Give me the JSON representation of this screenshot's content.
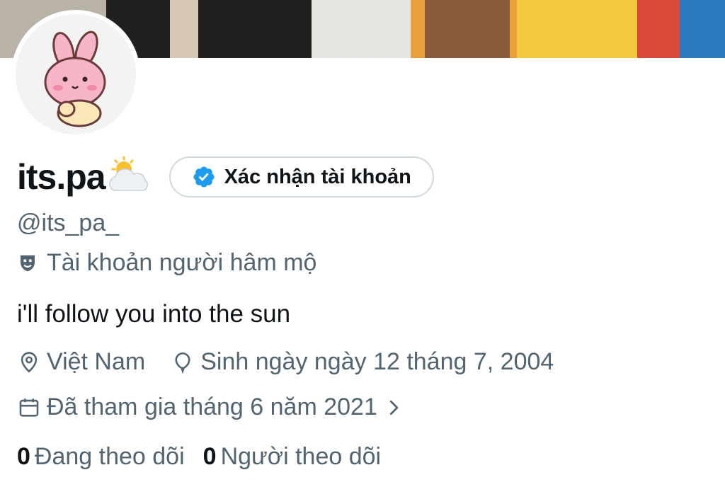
{
  "profile": {
    "display_name": "its.pa",
    "name_emoji": "sun-behind-cloud",
    "verify_button_label": "Xác nhận tài khoản",
    "handle": "@its_pa_",
    "category": "Tài khoản người hâm mộ",
    "bio": "i'll follow you into the sun",
    "location": "Việt Nam",
    "birthday": "Sinh ngày ngày 12 tháng 7, 2004",
    "joined": "Đã tham gia tháng 6 năm 2021"
  },
  "stats": {
    "following_count": "0",
    "following_label": "Đang theo dõi",
    "followers_count": "0",
    "followers_label": "Người theo dõi"
  },
  "icons": {
    "verify": "verified-badge-icon",
    "category": "theater-masks-icon",
    "location": "location-pin-icon",
    "birthday": "balloon-icon",
    "joined": "calendar-icon",
    "joined_arrow": "chevron-right-icon"
  },
  "colors": {
    "verified_blue": "#1d9bf0",
    "secondary_text": "#536471",
    "primary_text": "#0f1419",
    "border": "#cfd9de"
  }
}
